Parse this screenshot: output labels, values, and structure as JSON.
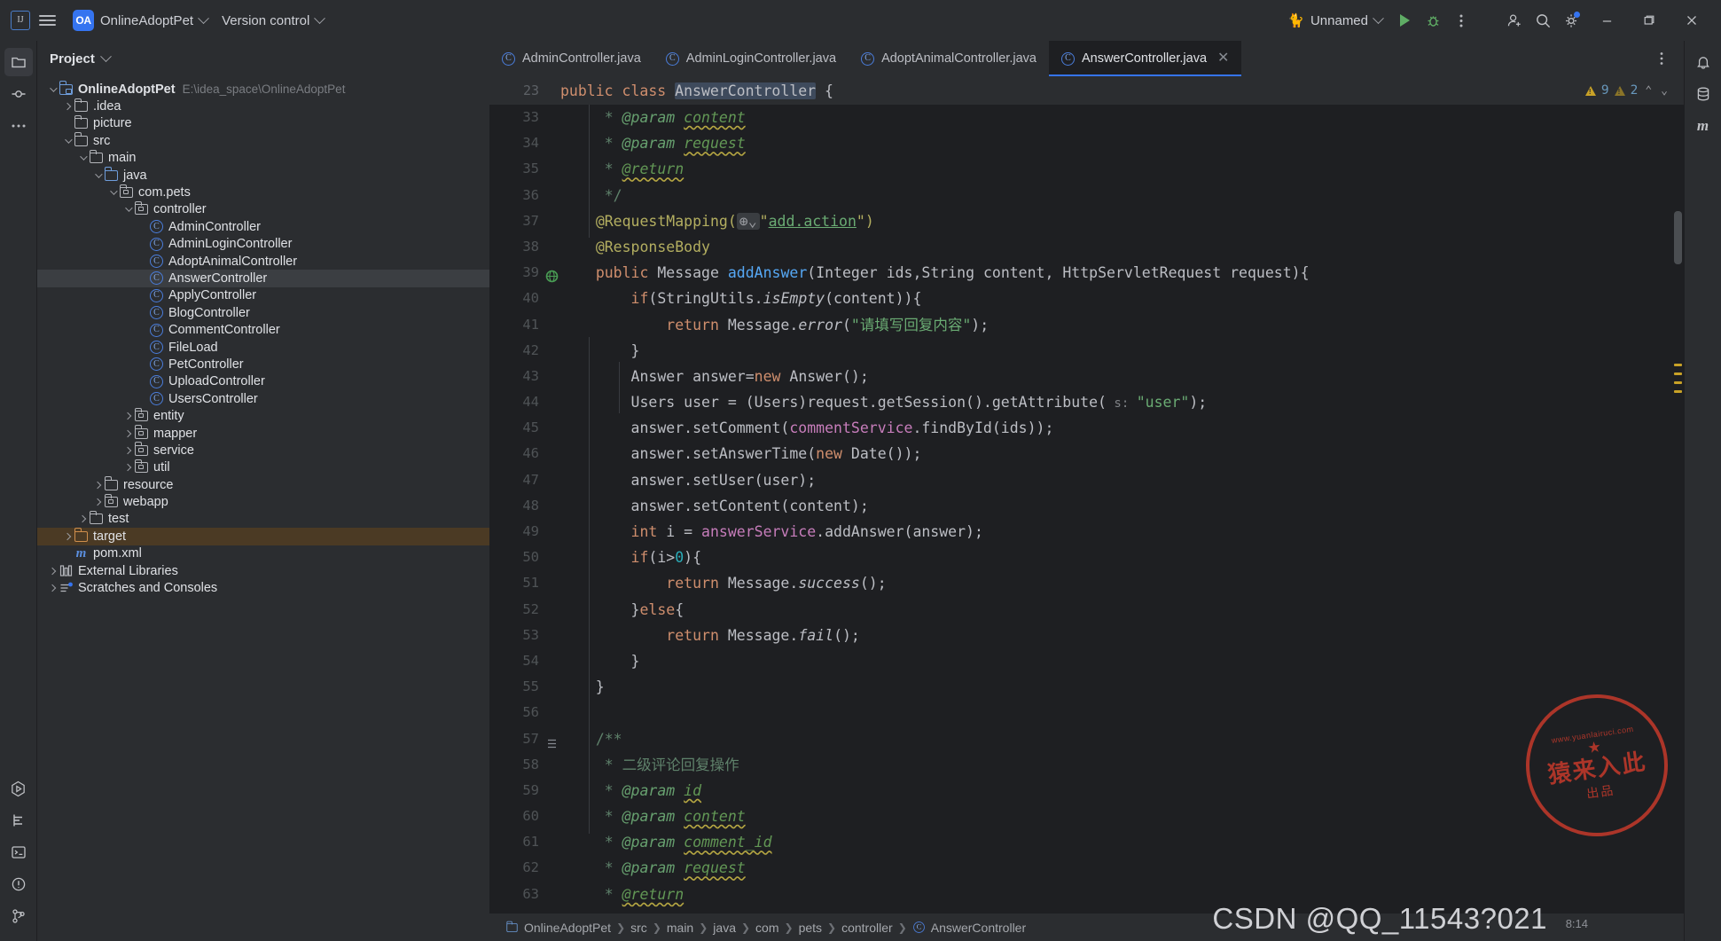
{
  "titlebar": {
    "menu_icon": "hamburger-menu-icon",
    "project_badge": "OA",
    "project_name": "OnlineAdoptPet",
    "version_control": "Version control",
    "run_config": "Unnamed",
    "run_icon": "tomcat-icon",
    "play_label": "Run",
    "debug_label": "Debug",
    "more_label": "More actions",
    "account_label": "Account",
    "search_label": "Search everywhere",
    "settings_label": "Settings",
    "minimize": "–",
    "maximize": "❐",
    "close": "✕"
  },
  "left_rail": [
    {
      "name": "project-tool-icon",
      "glyph": "folder"
    },
    {
      "name": "commit-tool-icon",
      "glyph": "commit"
    },
    {
      "name": "more-tool-windows-icon",
      "glyph": "dots"
    }
  ],
  "left_rail_bottom": [
    {
      "name": "run-tool-icon",
      "glyph": "run"
    },
    {
      "name": "structure-tool-icon",
      "glyph": "structure"
    },
    {
      "name": "terminal-tool-icon",
      "glyph": "terminal"
    },
    {
      "name": "problems-tool-icon",
      "glyph": "problems"
    },
    {
      "name": "version-control-tool-icon",
      "glyph": "branch"
    }
  ],
  "right_rail": [
    {
      "name": "notifications-icon",
      "glyph": "bell"
    },
    {
      "name": "database-icon",
      "glyph": "database"
    },
    {
      "name": "maven-icon",
      "glyph": "m"
    }
  ],
  "tool_window": {
    "title": "Project",
    "tree": [
      {
        "depth": 0,
        "arrow": "down",
        "icon": "module-folder",
        "label": "OnlineAdoptPet",
        "bold": true,
        "sub": "E:\\idea_space\\OnlineAdoptPet"
      },
      {
        "depth": 1,
        "arrow": "right",
        "icon": "folder",
        "label": ".idea"
      },
      {
        "depth": 1,
        "arrow": "none",
        "icon": "folder",
        "label": "picture"
      },
      {
        "depth": 1,
        "arrow": "down",
        "icon": "folder",
        "label": "src"
      },
      {
        "depth": 2,
        "arrow": "down",
        "icon": "folder",
        "label": "main"
      },
      {
        "depth": 3,
        "arrow": "down",
        "icon": "source-folder",
        "label": "java"
      },
      {
        "depth": 4,
        "arrow": "down",
        "icon": "package",
        "label": "com.pets"
      },
      {
        "depth": 5,
        "arrow": "down",
        "icon": "package",
        "label": "controller"
      },
      {
        "depth": 6,
        "arrow": "none",
        "icon": "class",
        "label": "AdminController"
      },
      {
        "depth": 6,
        "arrow": "none",
        "icon": "class",
        "label": "AdminLoginController"
      },
      {
        "depth": 6,
        "arrow": "none",
        "icon": "class",
        "label": "AdoptAnimalController"
      },
      {
        "depth": 6,
        "arrow": "none",
        "icon": "class",
        "label": "AnswerController",
        "selected": true
      },
      {
        "depth": 6,
        "arrow": "none",
        "icon": "class",
        "label": "ApplyController"
      },
      {
        "depth": 6,
        "arrow": "none",
        "icon": "class",
        "label": "BlogController"
      },
      {
        "depth": 6,
        "arrow": "none",
        "icon": "class",
        "label": "CommentController"
      },
      {
        "depth": 6,
        "arrow": "none",
        "icon": "class",
        "label": "FileLoad"
      },
      {
        "depth": 6,
        "arrow": "none",
        "icon": "class",
        "label": "PetController"
      },
      {
        "depth": 6,
        "arrow": "none",
        "icon": "class",
        "label": "UploadController"
      },
      {
        "depth": 6,
        "arrow": "none",
        "icon": "class",
        "label": "UsersController"
      },
      {
        "depth": 5,
        "arrow": "right",
        "icon": "package",
        "label": "entity"
      },
      {
        "depth": 5,
        "arrow": "right",
        "icon": "package",
        "label": "mapper"
      },
      {
        "depth": 5,
        "arrow": "right",
        "icon": "package",
        "label": "service"
      },
      {
        "depth": 5,
        "arrow": "right",
        "icon": "package",
        "label": "util"
      },
      {
        "depth": 3,
        "arrow": "right",
        "icon": "folder",
        "label": "resource"
      },
      {
        "depth": 3,
        "arrow": "right",
        "icon": "package",
        "label": "webapp"
      },
      {
        "depth": 2,
        "arrow": "right",
        "icon": "folder",
        "label": "test"
      },
      {
        "depth": 1,
        "arrow": "right",
        "icon": "folder-orange",
        "label": "target",
        "excluded": true
      },
      {
        "depth": 1,
        "arrow": "none",
        "icon": "maven",
        "label": "pom.xml"
      },
      {
        "depth": 0,
        "arrow": "right",
        "icon": "libraries",
        "label": "External Libraries"
      },
      {
        "depth": 0,
        "arrow": "right",
        "icon": "scratches",
        "label": "Scratches and Consoles"
      }
    ]
  },
  "editor": {
    "tabs": [
      {
        "label": "AdminController.java",
        "active": false
      },
      {
        "label": "AdminLoginController.java",
        "active": false
      },
      {
        "label": "AdoptAnimalController.java",
        "active": false
      },
      {
        "label": "AnswerController.java",
        "active": true,
        "closable": true
      }
    ],
    "sticky_line_number": "23",
    "sticky_text_before": "public class ",
    "sticky_text_name": "AnswerController",
    "sticky_text_after": " {",
    "inspections": {
      "warnings": "9",
      "weak_warnings": "2",
      "up_arrow": "⌃",
      "down_arrow": "⌄"
    },
    "first_line_number": 33,
    "lines": [
      {
        "n": "33",
        "html": "    <span class='jdoc'>* </span><span class='jtag'>@param </span><span class='jval'>content</span>"
      },
      {
        "n": "34",
        "html": "    <span class='jdoc'>* </span><span class='jtag'>@param </span><span class='jval'>request</span>"
      },
      {
        "n": "35",
        "html": "    <span class='jdoc'>* </span><span class='jval'>@return</span>"
      },
      {
        "n": "36",
        "html": "    <span class='jdoc'>*/</span>"
      },
      {
        "n": "37",
        "html": "   <span class='anno'>@RequestMapping(</span><span class='chint'>⊕⌄</span><span class='anno'>\"</span><span class='lnk'>add.action</span><span class='anno'>\")</span>"
      },
      {
        "n": "38",
        "html": "   <span class='anno'>@ResponseBody</span>"
      },
      {
        "n": "39",
        "gicon": "web-mapping",
        "html": "   <span class='kw'>public</span> <span class='cn'>Message</span> <span class='mth'>addAnswer</span>(<span class='cn'>Integer</span> ids,<span class='cn'>String</span> content, <span class='cn'>HttpServletRequest</span> request){"
      },
      {
        "n": "40",
        "html": "       <span class='kw'>if</span>(<span class='cn'>StringUtils</span>.<span class='stat'>isEmpty</span>(content)){"
      },
      {
        "n": "41",
        "html": "           <span class='kw'>return</span> <span class='cn'>Message</span>.<span class='stat'>error</span>(<span class='str'>\"请填写回复内容\"</span>);"
      },
      {
        "n": "42",
        "html": "       }"
      },
      {
        "n": "43",
        "html": "       <span class='cn'>Answer</span> answer=<span class='kw'>new</span> <span class='cn'>Answer</span>();"
      },
      {
        "n": "44",
        "html": "       <span class='cn'>Users</span> user = (<span class='cn'>Users</span>)request.getSession().getAttribute(<span class='hint'> s: </span><span class='str'>\"user\"</span>);"
      },
      {
        "n": "45",
        "html": "       answer.setComment(<span class='fld'>commentService</span>.findById(ids));"
      },
      {
        "n": "46",
        "html": "       answer.setAnswerTime(<span class='kw'>new</span> <span class='cn'>Date</span>());"
      },
      {
        "n": "47",
        "html": "       answer.setUser(user);"
      },
      {
        "n": "48",
        "html": "       answer.setContent(content);"
      },
      {
        "n": "49",
        "html": "       <span class='kw'>int</span> i = <span class='fld'>answerService</span>.addAnswer(answer);"
      },
      {
        "n": "50",
        "html": "       <span class='kw'>if</span>(i&gt;<span class='num'>0</span>){"
      },
      {
        "n": "51",
        "html": "           <span class='kw'>return</span> <span class='cn'>Message</span>.<span class='stat'>success</span>();"
      },
      {
        "n": "52",
        "html": "       }<span class='kw'>else</span>{"
      },
      {
        "n": "53",
        "html": "           <span class='kw'>return</span> <span class='cn'>Message</span>.<span class='stat'>fail</span>();"
      },
      {
        "n": "54",
        "html": "       }"
      },
      {
        "n": "55",
        "html": "   }"
      },
      {
        "n": "56",
        "html": ""
      },
      {
        "n": "57",
        "gicon": "fold",
        "html": "   <span class='jdoc'>/**</span>"
      },
      {
        "n": "58",
        "html": "    <span class='jdoc'>* 二级评论回复操作</span>"
      },
      {
        "n": "59",
        "html": "    <span class='jdoc'>* </span><span class='jtag'>@param </span><span class='jval'>id</span>"
      },
      {
        "n": "60",
        "html": "    <span class='jdoc'>* </span><span class='jtag'>@param </span><span class='jval'>content</span>"
      },
      {
        "n": "61",
        "html": "    <span class='jdoc'>* </span><span class='jtag'>@param </span><span class='jval'>comment_id</span>"
      },
      {
        "n": "62",
        "html": "    <span class='jdoc'>* </span><span class='jtag'>@param </span><span class='jval'>request</span>"
      },
      {
        "n": "63",
        "html": "    <span class='jdoc'>* </span><span class='jval'>@return</span>"
      }
    ]
  },
  "breadcrumb": [
    {
      "label": "OnlineAdoptPet",
      "icon": "module-icon"
    },
    {
      "label": "src",
      "icon": null
    },
    {
      "label": "main",
      "icon": null
    },
    {
      "label": "java",
      "icon": null
    },
    {
      "label": "com",
      "icon": null
    },
    {
      "label": "pets",
      "icon": null
    },
    {
      "label": "controller",
      "icon": null
    },
    {
      "label": "AnswerController",
      "icon": "class-icon"
    }
  ],
  "watermark": {
    "stamp_url": "www.yuanlairuci.com",
    "stamp_main": "猿来入此",
    "stamp_sub": "出品",
    "csdn": "CSDN @QQ_11543?021",
    "clock": "8:14"
  }
}
